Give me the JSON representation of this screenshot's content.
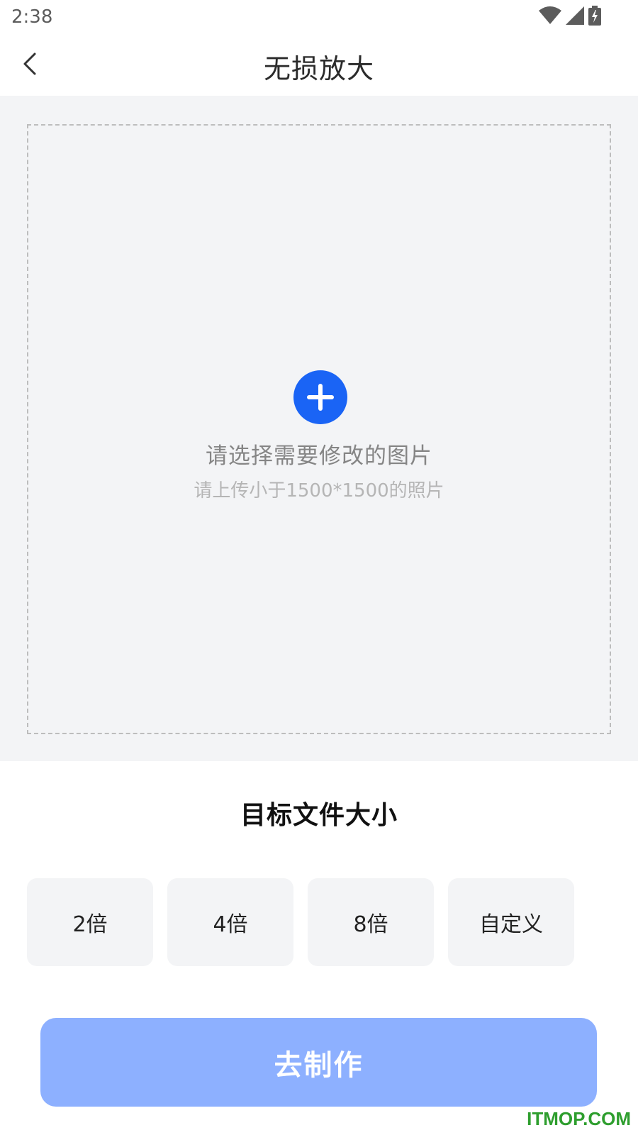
{
  "status_bar": {
    "time": "2:38",
    "icons": [
      "wifi-icon",
      "cellular-signal-icon",
      "battery-charging-icon"
    ]
  },
  "nav": {
    "title": "无损放大",
    "back_icon": "chevron-left-icon"
  },
  "upload": {
    "icon": "add-circle-icon",
    "hint": "请选择需要修改的图片",
    "subhint": "请上传小于1500*1500的照片"
  },
  "target_size": {
    "title": "目标文件大小",
    "options": [
      {
        "label": "2倍"
      },
      {
        "label": "4倍"
      },
      {
        "label": "8倍"
      },
      {
        "label": "自定义"
      }
    ]
  },
  "submit": {
    "label": "去制作"
  },
  "watermark": "ITMOP.COM",
  "colors": {
    "accent": "#1a64f5",
    "button_disabled": "#8db0ff",
    "panel_bg": "#f3f4f6",
    "watermark": "#2e9e2e"
  }
}
